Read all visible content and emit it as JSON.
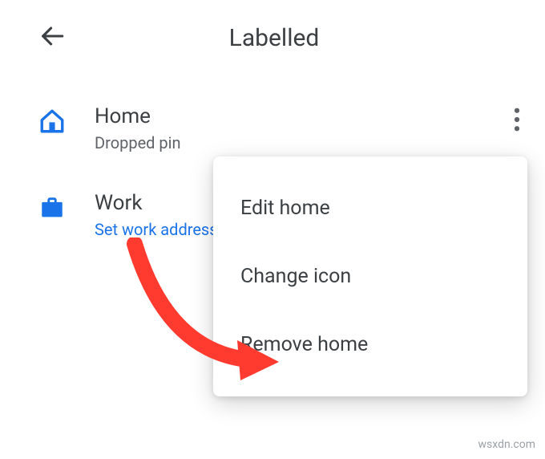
{
  "header": {
    "title": "Labelled"
  },
  "items": [
    {
      "title": "Home",
      "subtitle": "Dropped pin",
      "link": false
    },
    {
      "title": "Work",
      "subtitle": "Set work address",
      "link": true
    }
  ],
  "menu": {
    "items": [
      "Edit home",
      "Change icon",
      "Remove home"
    ]
  },
  "watermark": "wsxdn.com",
  "colors": {
    "accent": "#1a73e8",
    "arrow": "#ff3b30"
  }
}
